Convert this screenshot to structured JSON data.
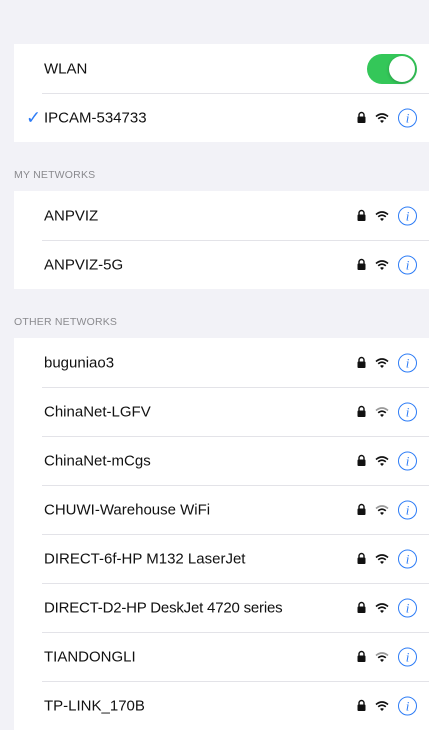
{
  "wlan": {
    "label": "WLAN",
    "enabled": true,
    "toggle_color": "#34c759"
  },
  "connected": {
    "name": "IPCAM-534733",
    "check_icon": "checkmark-icon",
    "check_glyph": "✓"
  },
  "my_networks": {
    "header": "MY NETWORKS",
    "items": [
      {
        "name": "ANPVIZ"
      },
      {
        "name": "ANPVIZ-5G"
      }
    ]
  },
  "other_networks": {
    "header": "OTHER NETWORKS",
    "items": [
      {
        "name": "buguniao3"
      },
      {
        "name": "ChinaNet-LGFV"
      },
      {
        "name": "ChinaNet-mCgs"
      },
      {
        "name": "CHUWI-Warehouse WiFi"
      },
      {
        "name": "DIRECT-6f-HP M132 LaserJet"
      },
      {
        "name": "DIRECT-D2-HP DeskJet 4720 series"
      },
      {
        "name": "TIANDONGLI"
      },
      {
        "name": "TP-LINK_170B"
      }
    ]
  },
  "icons": {
    "lock": "lock-icon",
    "wifi": "wifi-icon",
    "info": "info-icon",
    "info_glyph": "i"
  },
  "colors": {
    "accent": "#2d7cf6",
    "background": "#f2f2f7",
    "section_text": "#8a8a8e"
  }
}
